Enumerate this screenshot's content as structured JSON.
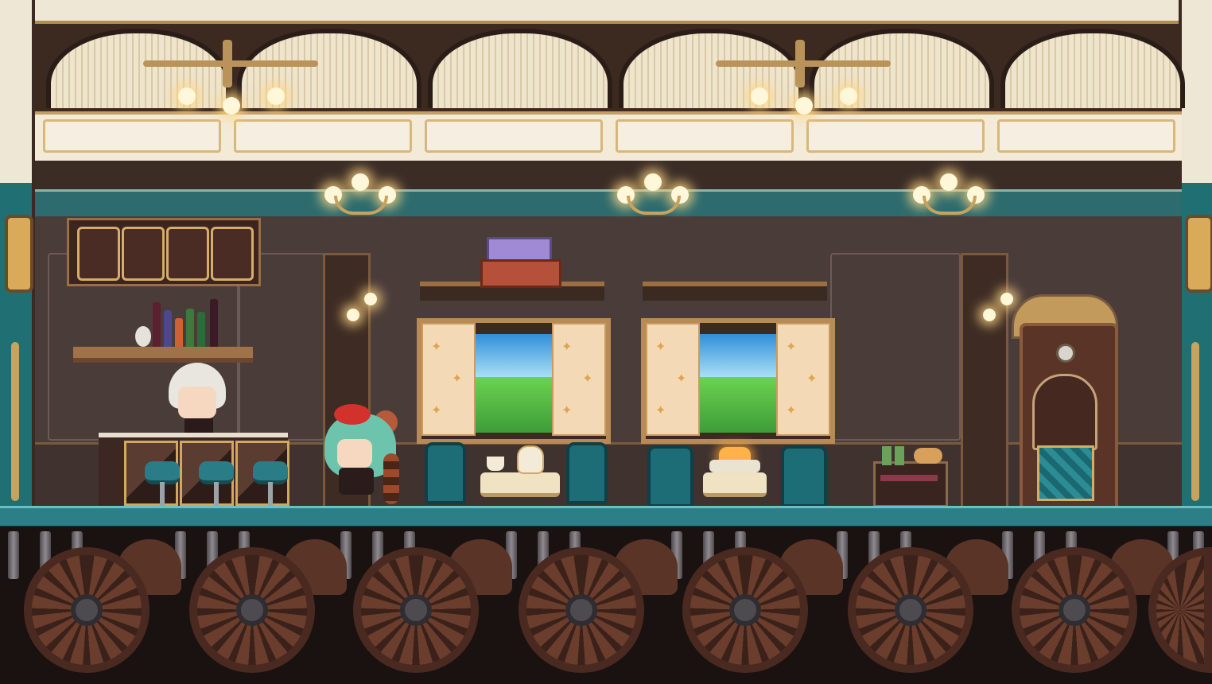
{
  "scene": {
    "title": "",
    "location": "train dining car"
  },
  "colors": {
    "floor_teal": "#2c7f86",
    "wall_brown": "#4a3c39",
    "gold_trim": "#c9a25e",
    "cream": "#efe7d6",
    "lamp_glow": "#fff7d9"
  },
  "icons": {
    "chandelier": "chandelier-icon",
    "sconce": "wall-sconce-icon",
    "wheel": "train-wheel-icon",
    "bottle": "bottle-icon",
    "door": "door-icon"
  },
  "characters": [
    {
      "id": "bartender",
      "description": "white-haired bartender"
    },
    {
      "id": "player",
      "description": "green-haired girl with red bow and striped tail"
    }
  ]
}
